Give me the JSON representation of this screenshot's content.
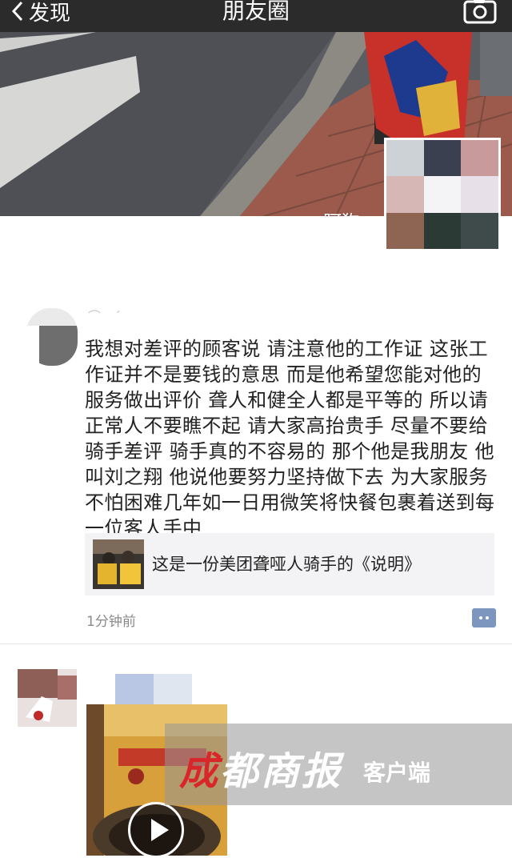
{
  "navbar": {
    "back_label": "发现",
    "title": "朋友圈",
    "camera_icon": "camera-icon"
  },
  "cover": {
    "name": "阿狗"
  },
  "post": {
    "text": "我想对差评的顾客说 请注意他的工作证 这张工作证并不是要钱的意思  而是他希望您能对他的服务做出评价  聋人和健全人都是平等的  所以请正常人不要瞧不起  请大家高抬贵手 尽量不要给骑手差评 骑手真的不容易的  那个他是我朋友  他叫刘之翔 他说他要努力坚持做下去 为大家服务  不怕困难几年如一日用微笑将快餐包裹着送到每一位客人手中",
    "share_title": "这是一份美团聋哑人骑手的《说明》",
    "time": "1分钟前",
    "comment_icon": "comment-dots-icon"
  },
  "watermark": {
    "brand": "成都商报",
    "brand_first": "成",
    "brand_rest": "都商报",
    "sub": "客户端"
  },
  "colors": {
    "navbar": "#2b2b2b",
    "link": "#576b95",
    "watermark_red": "#d9262b"
  }
}
